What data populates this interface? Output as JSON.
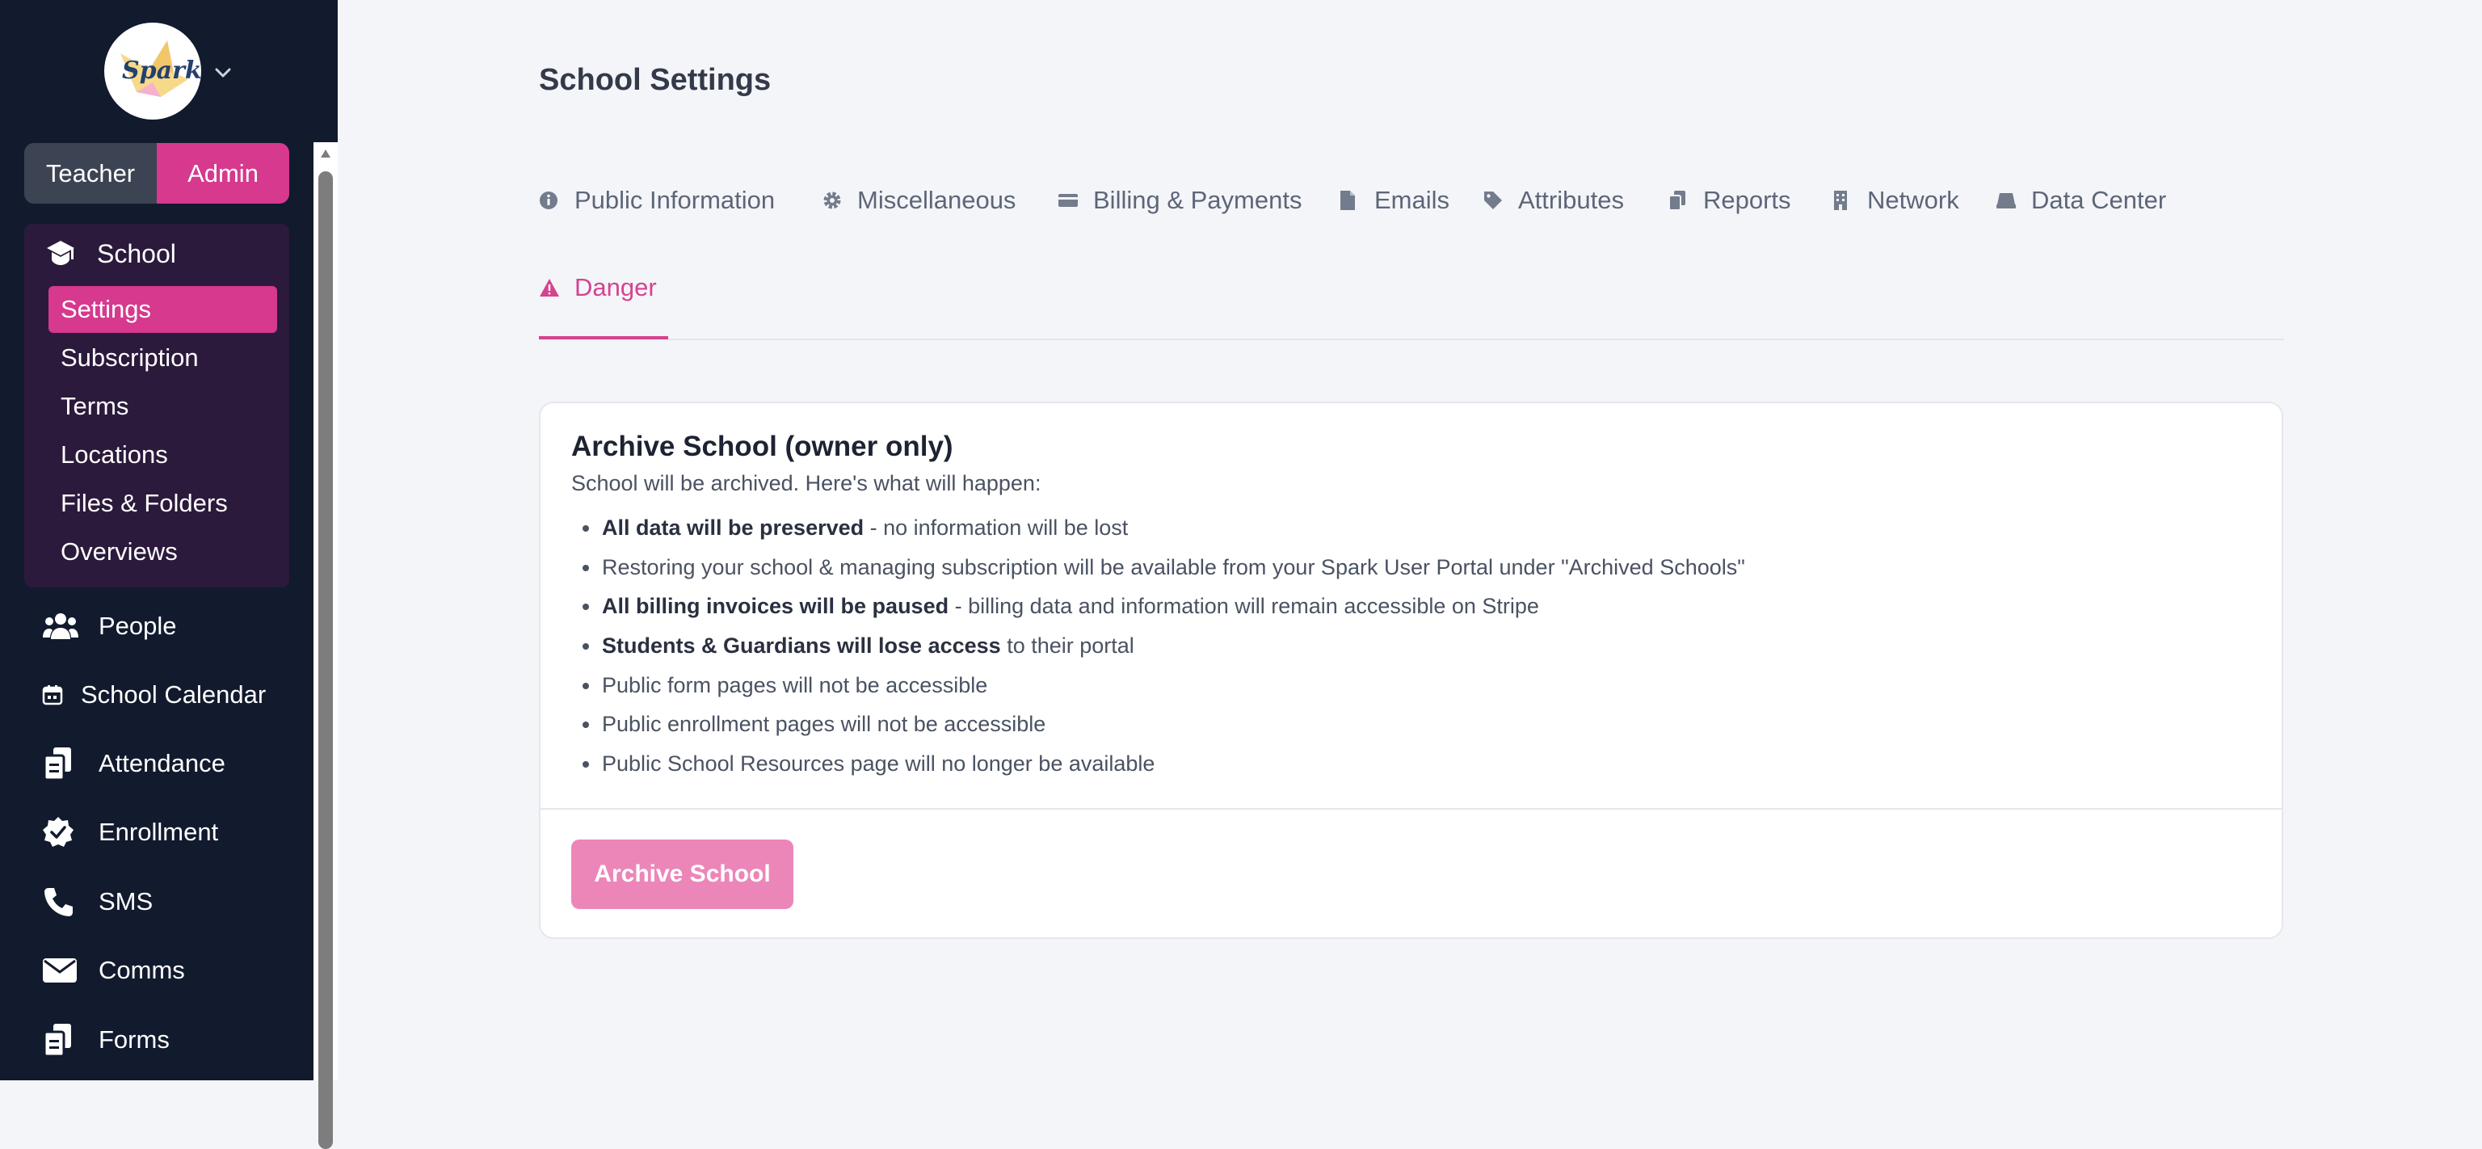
{
  "logo": {
    "text": "Spark",
    "icon": "spark-logo"
  },
  "role_toggle": {
    "teacher": "Teacher",
    "admin": "Admin",
    "active": "admin"
  },
  "sidebar": {
    "school": {
      "label": "School",
      "icon": "graduation-cap-icon",
      "items": [
        {
          "label": "Settings",
          "active": true
        },
        {
          "label": "Subscription"
        },
        {
          "label": "Terms"
        },
        {
          "label": "Locations"
        },
        {
          "label": "Files & Folders"
        },
        {
          "label": "Overviews"
        }
      ]
    },
    "items": [
      {
        "label": "People",
        "icon": "users-icon"
      },
      {
        "label": "School Calendar",
        "icon": "calendar-icon"
      },
      {
        "label": "Attendance",
        "icon": "clipboard-icon"
      },
      {
        "label": "Enrollment",
        "icon": "badge-check-icon"
      },
      {
        "label": "SMS",
        "icon": "phone-icon"
      },
      {
        "label": "Comms",
        "icon": "envelope-icon"
      },
      {
        "label": "Forms",
        "icon": "forms-icon"
      }
    ]
  },
  "page": {
    "title": "School Settings"
  },
  "tabs": [
    {
      "label": "Public Information",
      "icon": "info-icon"
    },
    {
      "label": "Miscellaneous",
      "icon": "gear-icon"
    },
    {
      "label": "Billing & Payments",
      "icon": "credit-card-icon"
    },
    {
      "label": "Emails",
      "icon": "document-icon"
    },
    {
      "label": "Attributes",
      "icon": "tag-icon"
    },
    {
      "label": "Reports",
      "icon": "reports-icon"
    },
    {
      "label": "Network",
      "icon": "building-icon"
    },
    {
      "label": "Data Center",
      "icon": "server-icon"
    },
    {
      "label": "Danger",
      "icon": "warning-icon",
      "active": true
    }
  ],
  "card": {
    "title": "Archive School (owner only)",
    "description": "School will be archived. Here's what will happen:",
    "items": [
      {
        "bold": "All data will be preserved",
        "text": " - no information will be lost"
      },
      {
        "bold": "",
        "text": "Restoring your school & managing subscription will be available from your Spark User Portal under \"Archived Schools\""
      },
      {
        "bold": "All billing invoices will be paused",
        "text": " - billing data and information will remain accessible on Stripe"
      },
      {
        "bold": "Students & Guardians will lose access",
        "text": " to their portal"
      },
      {
        "bold": "",
        "text": "Public form pages will not be accessible"
      },
      {
        "bold": "",
        "text": "Public enrollment pages will not be accessible"
      },
      {
        "bold": "",
        "text": "Public School Resources page will no longer be available"
      }
    ],
    "button_label": "Archive School"
  },
  "colors": {
    "accent": "#d6398e",
    "sidebar_bg": "#121a2e",
    "button": "#ec86b9"
  }
}
